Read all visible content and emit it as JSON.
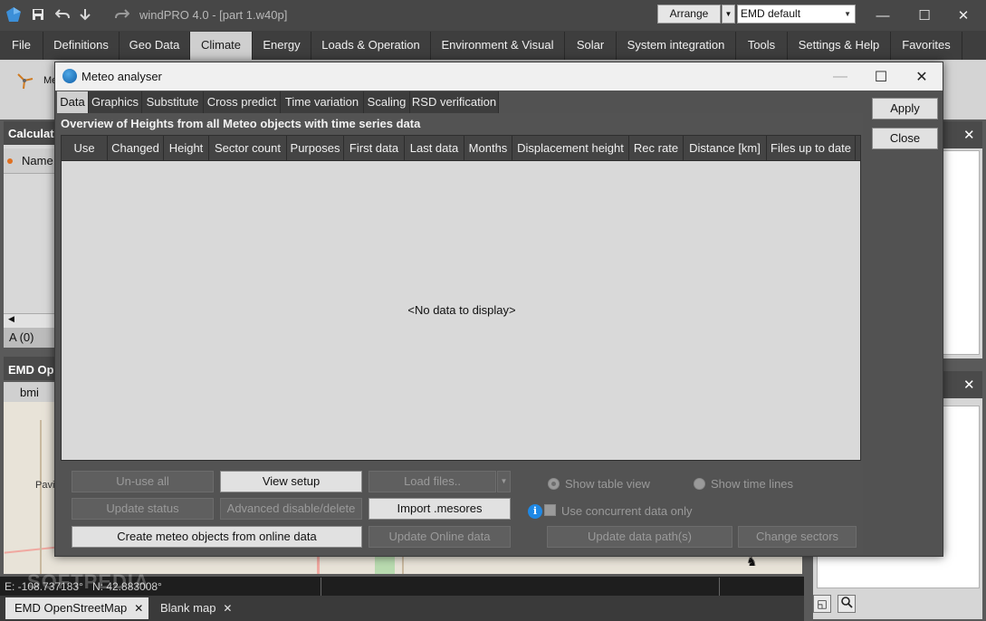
{
  "app": {
    "title": "windPRO 4.0 - [part 1.w40p]",
    "arrange_label": "Arrange",
    "map_style_select": "EMD default",
    "icons": [
      "windpro-logo-icon",
      "save-icon",
      "undo-icon",
      "download-icon",
      "redo-icon"
    ]
  },
  "menu": {
    "items": [
      {
        "label": "File"
      },
      {
        "label": "Definitions"
      },
      {
        "label": "Geo Data"
      },
      {
        "label": "Climate"
      },
      {
        "label": "Energy"
      },
      {
        "label": "Loads & Operation"
      },
      {
        "label": "Environment & Visual"
      },
      {
        "label": "Solar"
      },
      {
        "label": "System integration"
      },
      {
        "label": "Tools"
      },
      {
        "label": "Settings & Help"
      },
      {
        "label": "Favorites"
      }
    ],
    "active": "Climate"
  },
  "background": {
    "ribbon_label": "Me",
    "calc_panel_title": "Calculati",
    "name_column": "Name",
    "a_tab": "A (0)",
    "emd_panel_title": "EMD Ope",
    "bmi_label": "bmi",
    "map_place": "Pavill",
    "coord_e": "E: -108.737183°",
    "coord_n": "N: 42.883008°",
    "watermark": "SOFTPEDIA",
    "bottom_tabs": [
      {
        "label": "EMD OpenStreetMap"
      },
      {
        "label": "Blank map"
      }
    ]
  },
  "dialog": {
    "title": "Meteo analyser",
    "tabs": [
      {
        "label": "Data"
      },
      {
        "label": "Graphics"
      },
      {
        "label": "Substitute"
      },
      {
        "label": "Cross predict"
      },
      {
        "label": "Time variation"
      },
      {
        "label": "Scaling"
      },
      {
        "label": "RSD verification"
      }
    ],
    "active_tab": "Data",
    "overview_title": "Overview of Heights from all Meteo objects with time series data",
    "columns": [
      "Use",
      "Changed",
      "Height",
      "Sector count",
      "Purposes",
      "First data",
      "Last data",
      "Months",
      "Displacement height",
      "Rec rate",
      "Distance [km]",
      "Files up to date"
    ],
    "empty_text": "<No data to display>",
    "buttons": {
      "unuse_all": "Un-use all",
      "view_setup": "View setup",
      "load_files": "Load files..",
      "update_status": "Update status",
      "advanced_disable": "Advanced disable/delete",
      "import_mesores": "Import .mesores",
      "create_meteo": "Create meteo objects from online data",
      "update_online": "Update Online data",
      "update_path": "Update data path(s)",
      "change_sectors": "Change sectors",
      "apply": "Apply",
      "close": "Close"
    },
    "options": {
      "show_table_view": "Show table view",
      "show_time_lines": "Show time lines",
      "use_concurrent": "Use concurrent data only"
    }
  }
}
